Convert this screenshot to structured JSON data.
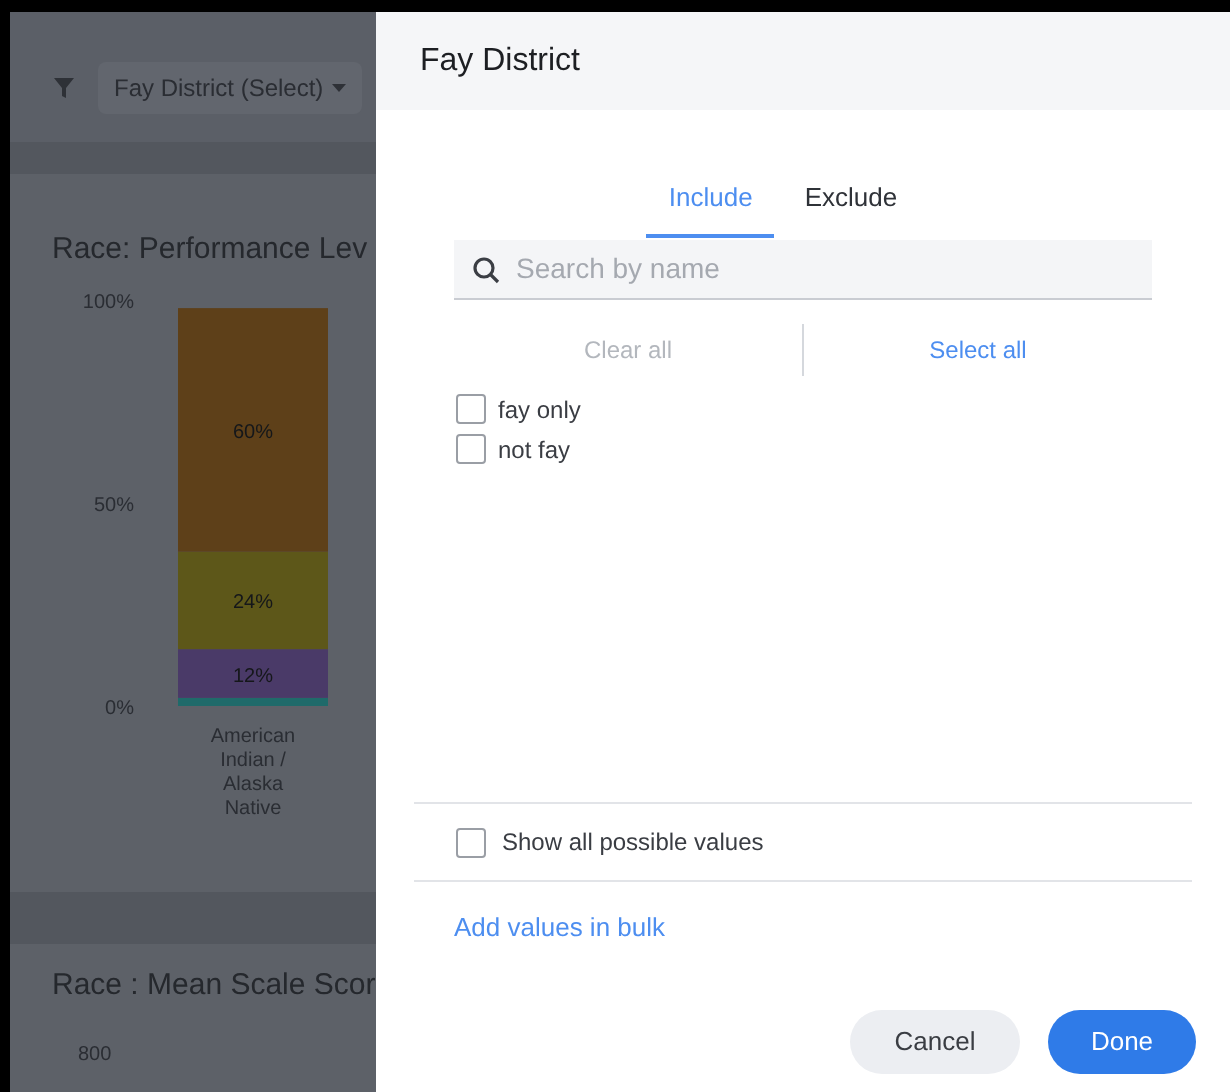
{
  "filter_bar": {
    "chip": "Fay District (Select)"
  },
  "chart_card": {
    "title": "Race: Performance Lev",
    "chart_data": {
      "type": "bar",
      "stacked": true,
      "categories": [
        "American Indian / Alaska Native"
      ],
      "yticks": [
        {
          "value": 0,
          "label": "0%"
        },
        {
          "value": 50,
          "label": "50%"
        },
        {
          "value": 100,
          "label": "100%"
        }
      ],
      "ylim": [
        0,
        100
      ],
      "series": [
        {
          "color": "#1f6a6a",
          "values": [
            2
          ]
        },
        {
          "color": "#4a3a68",
          "values": [
            12
          ]
        },
        {
          "color": "#5d5719",
          "values": [
            24
          ]
        },
        {
          "color": "#5e4019",
          "values": [
            60
          ]
        }
      ],
      "value_labels": [
        [
          null,
          "12%",
          "24%",
          "60%"
        ]
      ]
    }
  },
  "second_card": {
    "title": "Race : Mean Scale Scor",
    "axis_label": "800"
  },
  "dialog": {
    "title": "Fay District",
    "tabs": [
      {
        "label": "Include",
        "selected": true
      },
      {
        "label": "Exclude",
        "selected": false
      }
    ],
    "search": {
      "placeholder": "Search by name"
    },
    "actions": [
      {
        "label": "Clear all",
        "disabled": true
      },
      {
        "label": "Select all",
        "disabled": false
      }
    ],
    "values": [
      {
        "label": "fay only",
        "checked": false
      },
      {
        "label": "not fay",
        "checked": false
      }
    ],
    "show_all": {
      "label": "Show all possible values",
      "checked": false
    },
    "bulk_link": "Add values in bulk",
    "buttons": [
      {
        "label": "Cancel",
        "kind": "secondary"
      },
      {
        "label": "Done",
        "kind": "primary"
      }
    ]
  }
}
